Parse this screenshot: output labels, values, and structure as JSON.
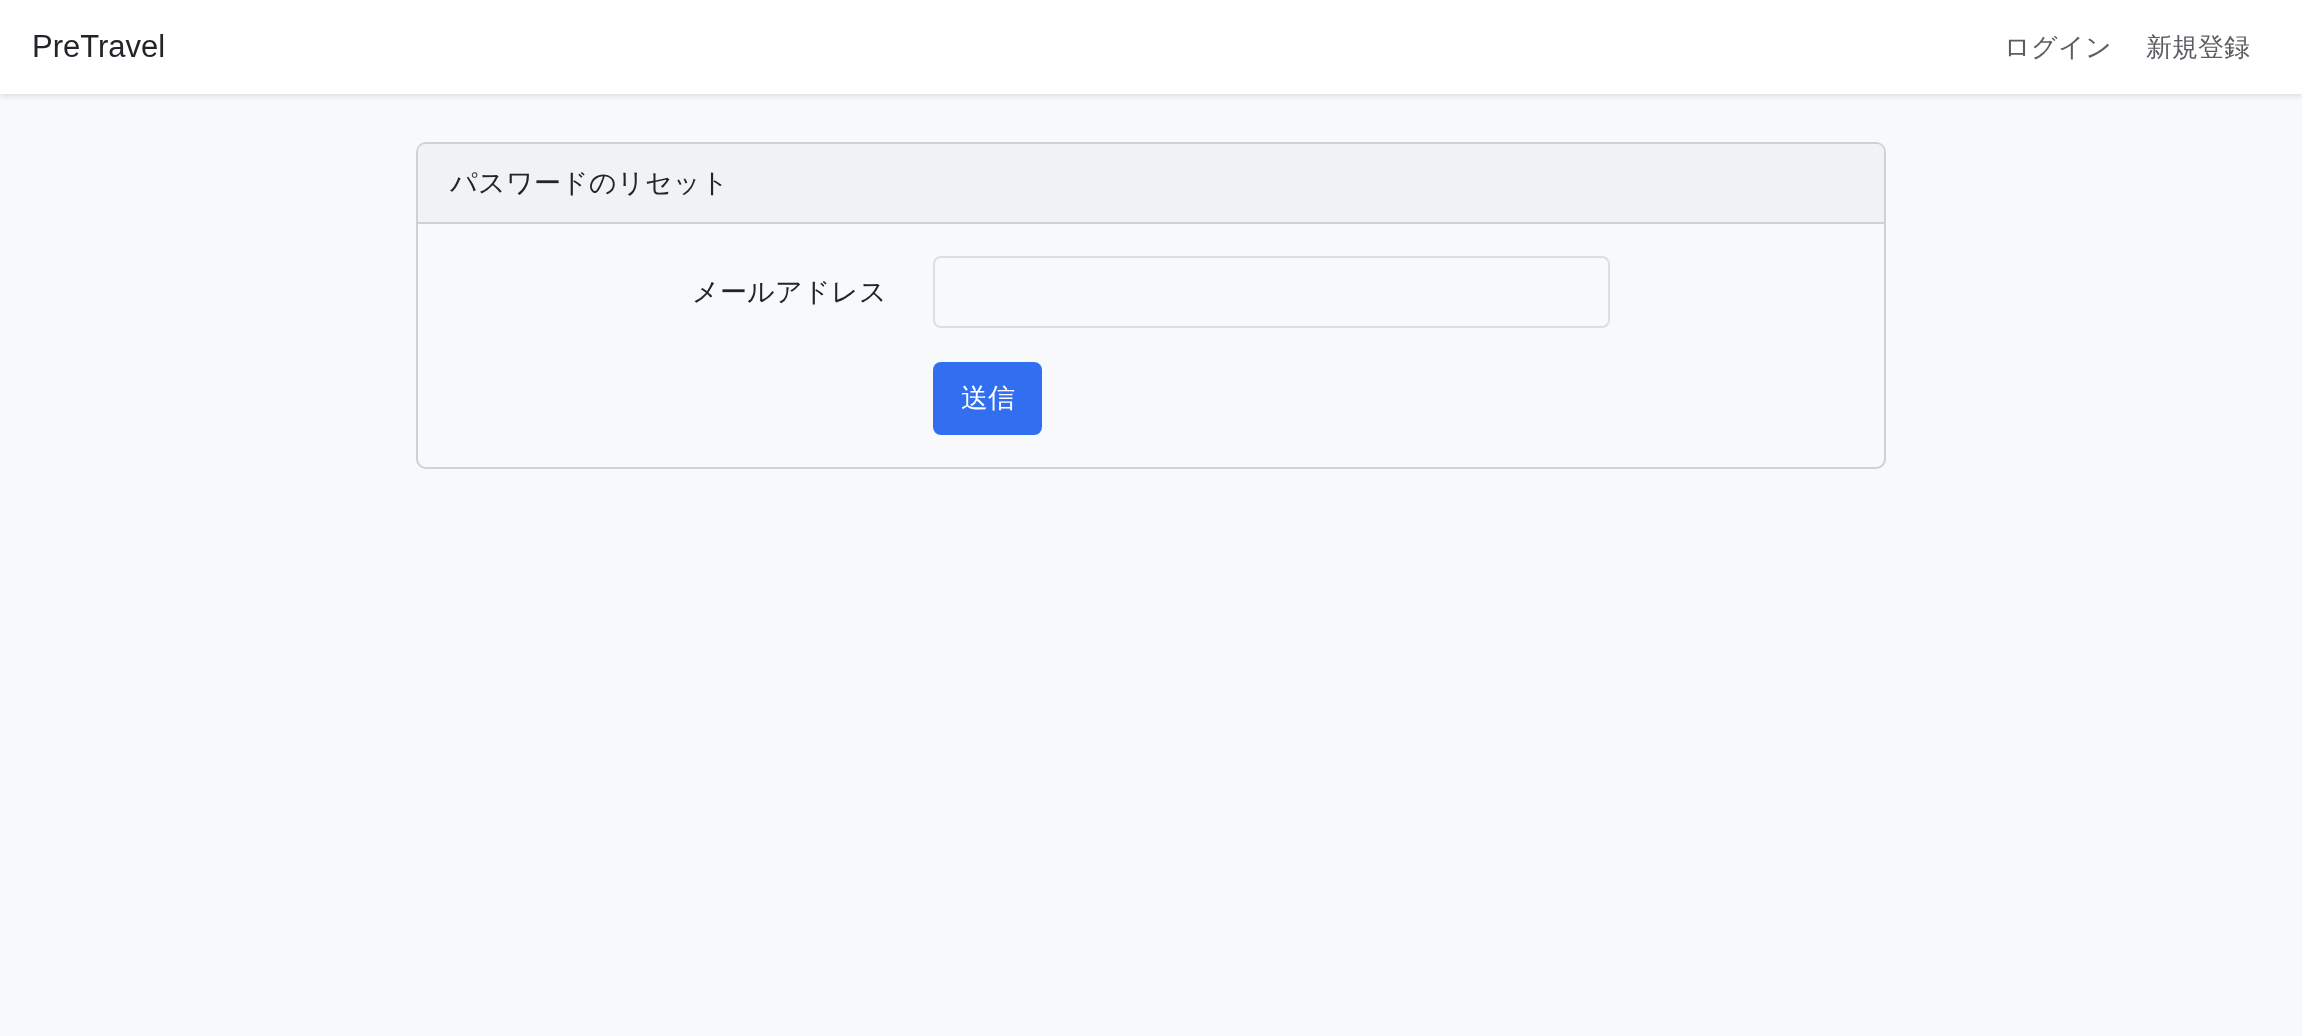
{
  "navbar": {
    "brand": "PreTravel",
    "links": [
      {
        "label": "ログイン"
      },
      {
        "label": "新規登録"
      }
    ]
  },
  "card": {
    "title": "パスワードのリセット",
    "email_label": "メールアドレス",
    "submit_button": "送信"
  }
}
